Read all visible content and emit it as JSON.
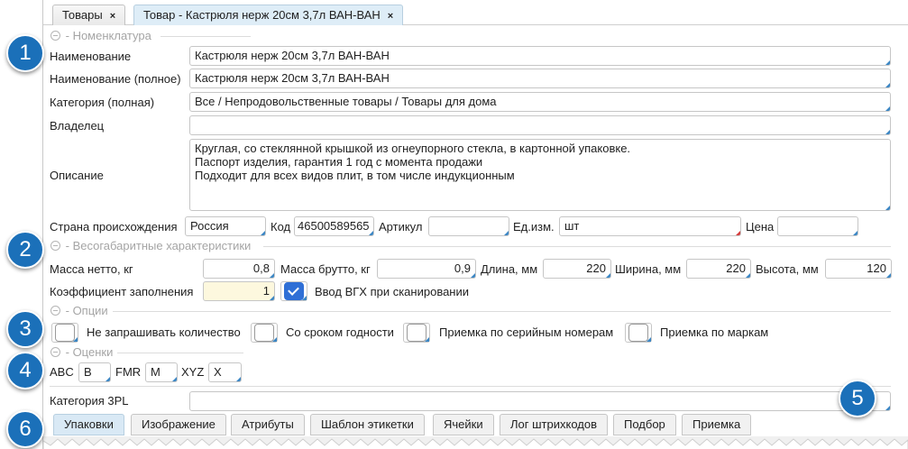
{
  "top_tabs": [
    {
      "label": "Товары",
      "close": "×"
    },
    {
      "label": "Товар - Кастрюля нерж 20см 3,7л ВАН-ВАН",
      "close": "×"
    }
  ],
  "sections": {
    "nomenclature": "Номенклатура",
    "dimensions": "Весогабаритные характеристики",
    "options": "Опции",
    "ratings": "Оценки"
  },
  "badges": [
    "1",
    "2",
    "3",
    "4",
    "5",
    "6"
  ],
  "fields": {
    "name": {
      "label": "Наименование",
      "value": "Кастрюля нерж 20см 3,7л ВАН-ВАН"
    },
    "full_name": {
      "label": "Наименование (полное)",
      "value": "Кастрюля нерж 20см 3,7л ВАН-ВАН"
    },
    "category": {
      "label": "Категория (полная)",
      "value": "Все / Непродовольственные товары / Товары для дома"
    },
    "owner": {
      "label": "Владелец",
      "value": ""
    },
    "description": {
      "label": "Описание",
      "lines": [
        "Круглая, со стеклянной крышкой из огнеупорного стекла, в картонной упаковке.",
        "Паспорт изделия, гарантия 1 год с момента продажи",
        "Подходит для всех видов плит, в том числе индукционным"
      ]
    },
    "country": {
      "label": "Страна происхождения",
      "value": "Россия"
    },
    "code": {
      "label": "Код",
      "value": "46500589565"
    },
    "article": {
      "label": "Артикул",
      "value": ""
    },
    "unit": {
      "label": "Ед.изм.",
      "value": "шт"
    },
    "price": {
      "label": "Цена",
      "value": ""
    }
  },
  "dims": {
    "net": {
      "label": "Масса нетто, кг",
      "value": "0,8"
    },
    "gross": {
      "label": "Масса брутто, кг",
      "value": "0,9"
    },
    "length": {
      "label": "Длина, мм",
      "value": "220"
    },
    "width": {
      "label": "Ширина, мм",
      "value": "220"
    },
    "height": {
      "label": "Высота, мм",
      "value": "120"
    },
    "fill": {
      "label": "Коэффициент заполнения",
      "value": "1"
    },
    "scan_vgh": {
      "label": "Ввод ВГХ при сканировании",
      "checked": true
    }
  },
  "options": [
    {
      "label": "Не запрашивать количество",
      "checked": false
    },
    {
      "label": "Со сроком годности",
      "checked": false
    },
    {
      "label": "Приемка по серийным номерам",
      "checked": false
    },
    {
      "label": "Приемка по маркам",
      "checked": false
    }
  ],
  "ratings": {
    "abc": {
      "label": "ABC",
      "value": "B"
    },
    "fmr": {
      "label": "FMR",
      "value": "M"
    },
    "xyz": {
      "label": "XYZ",
      "value": "X"
    }
  },
  "category_3pl": {
    "label": "Категория 3PL",
    "value": ""
  },
  "bottom_tabs": [
    "Упаковки",
    "Изображение",
    "Атрибуты",
    "Шаблон этикетки",
    "Ячейки",
    "Лог штрихкодов",
    "Подбор",
    "Приемка"
  ],
  "colors": {
    "badge": "#1b70b9",
    "checkbox_on": "#2f6fd6",
    "active_tab": "#deedf7",
    "field_marker": "#3b86c4",
    "required_marker": "#d43b3b"
  }
}
